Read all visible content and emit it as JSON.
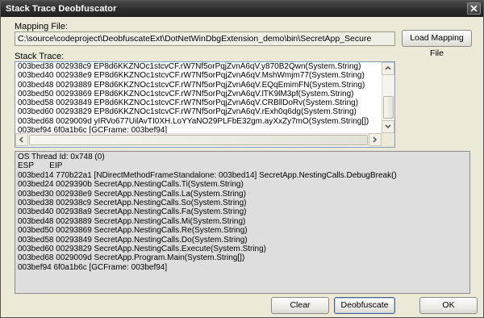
{
  "window": {
    "title": "Stack Trace Deobfuscator"
  },
  "mapping": {
    "label": "Mapping File:",
    "value": "C:\\source\\codeproject\\DeobfuscateExt\\DotNetWinDbgExtension_demo\\bin\\SecretApp_Secure",
    "load_button": "Load Mapping File"
  },
  "stack_trace": {
    "label": "Stack Trace:",
    "lines": [
      "003bed38 002938c9 EP8d6KKZNOc1stcvCF.rW7Nf5orPqjZvnA6qV.y870B2Qwn(System.String)",
      "003bed40 002938e9 EP8d6KKZNOc1stcvCF.rW7Nf5orPqjZvnA6qV.MshWmjm77(System.String)",
      "003bed48 00293889 EP8d6KKZNOc1stcvCF.rW7Nf5orPqjZvnA6qV.EQqEmimFN(System.String)",
      "003bed50 00293869 EP8d6KKZNOc1stcvCF.rW7Nf5orPqjZvnA6qV.lTK9lM3pf(System.String)",
      "003bed58 00293849 EP8d6KKZNOc1stcvCF.rW7Nf5orPqjZvnA6qV.CRBllDoRv(System.String)",
      "003bed60 00293829 EP8d6KKZNOc1stcvCF.rW7Nf5orPqjZvnA6qV.rExh0q6dg(System.String)",
      "003bed68 0029009d yIRVo677UilAvTI0XH.LoYYaNO29PLFbE32gm.ayXxZy7mO(System.String[])",
      "003bef94 6f0a1b6c [GCFrame: 003bef94]"
    ]
  },
  "output": {
    "lines": [
      "OS Thread Id: 0x748 (0)",
      "ESP       EIP",
      "003bed14 770b22a1 [NDirectMethodFrameStandalone: 003bed14] SecretApp.NestingCalls.DebugBreak()",
      "003bed24 0029390b SecretApp.NestingCalls.Ti(System.String)",
      "003bed30 002938e9 SecretApp.NestingCalls.La(System.String)",
      "003bed38 002938c9 SecretApp.NestingCalls.So(System.String)",
      "003bed40 002938a9 SecretApp.NestingCalls.Fa(System.String)",
      "003bed48 00293889 SecretApp.NestingCalls.Mi(System.String)",
      "003bed50 00293869 SecretApp.NestingCalls.Re(System.String)",
      "003bed58 00293849 SecretApp.NestingCalls.Do(System.String)",
      "003bed60 00293829 SecretApp.NestingCalls.Execute(System.String)",
      "003bed68 0029009d SecretApp.Program.Main(System.String[])",
      "003bef94 6f0a1b6c [GCFrame: 003bef94]"
    ]
  },
  "buttons": {
    "clear": "Clear",
    "deobfuscate": "Deobfuscate",
    "ok": "OK"
  },
  "icons": {
    "close": "close-icon",
    "scroll_up": "arrow-up-icon",
    "scroll_down": "arrow-down-icon",
    "scroll_left": "arrow-left-icon",
    "scroll_right": "arrow-right-icon"
  }
}
